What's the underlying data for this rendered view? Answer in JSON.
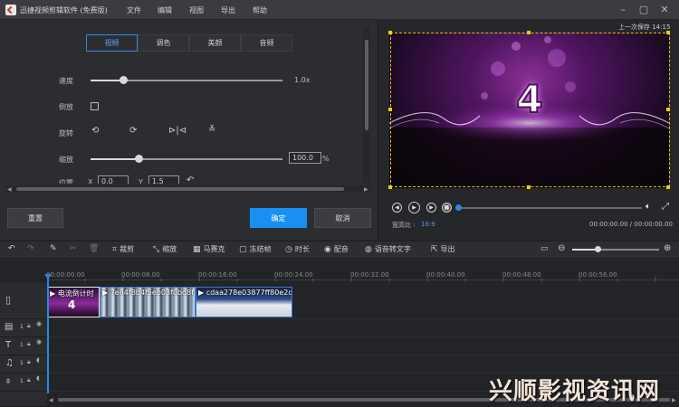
{
  "app": {
    "title": "迅捷视频剪辑软件 (免费版)",
    "menu": [
      "文件",
      "编辑",
      "视图",
      "导出",
      "帮助"
    ],
    "window_controls": [
      "minimize-icon",
      "restore-icon",
      "close-icon"
    ]
  },
  "editor": {
    "tabs": [
      "视频",
      "调色",
      "美颜",
      "音频"
    ],
    "active_tab": "视频",
    "speed": {
      "label": "速度",
      "value": "1.0x",
      "fraction": 0.17
    },
    "reverse": {
      "label": "倒放",
      "checked": false
    },
    "rotate": {
      "label": "旋转"
    },
    "scale": {
      "label": "缩放",
      "value": "100.0",
      "unit": "%",
      "fraction": 0.25
    },
    "position": {
      "label": "位置",
      "x_label": "X",
      "x_value": "0.0",
      "y_label": "Y",
      "y_value": "1.5"
    },
    "reset_label": "重置",
    "confirm_label": "确定",
    "cancel_label": "取消"
  },
  "preview": {
    "autosave": "上一次保存 14:15",
    "aspect_label": "宽高比 :",
    "aspect_value": "16:9",
    "time": "00:00:00.00 / 00:00:00.00",
    "countdown": "4"
  },
  "toolbar": {
    "crop": "裁剪",
    "zoom": "缩放",
    "mosaic": "马赛克",
    "freeze": "冻结帧",
    "duration": "时长",
    "dub": "配音",
    "speech_to_text": "语音转文字",
    "export": "导出"
  },
  "timeline": {
    "ruler": [
      "00:00:00.00",
      "00:00:08.00",
      "00:00:16.00",
      "00:00:24.00",
      "00:00:32.00",
      "00:00:40.00",
      "00:00:48.00",
      "00:00:56.00"
    ],
    "clips": [
      {
        "title": "电流倒计时"
      },
      {
        "title": "7e84f8b4f5eb03f0bd8f..."
      },
      {
        "title": "cdaa278e03877ff80e2d..."
      }
    ],
    "track_numbers": [
      "1",
      "1",
      "1",
      "1"
    ]
  },
  "watermark": "兴顺影视资讯网"
}
